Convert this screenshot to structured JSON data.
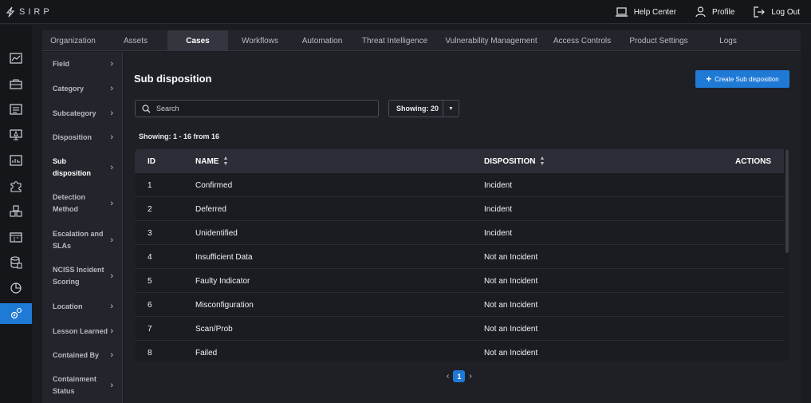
{
  "app": {
    "logo_text": "SIRP"
  },
  "top_actions": [
    {
      "name": "help-center",
      "label": "Help Center"
    },
    {
      "name": "profile",
      "label": "Profile"
    },
    {
      "name": "log-out",
      "label": "Log Out"
    }
  ],
  "tabs": [
    {
      "label": "Organization"
    },
    {
      "label": "Assets"
    },
    {
      "label": "Cases",
      "active": true
    },
    {
      "label": "Workflows"
    },
    {
      "label": "Automation"
    },
    {
      "label": "Threat Intelligence"
    },
    {
      "label": "Vulnerability Management"
    },
    {
      "label": "Access Controls"
    },
    {
      "label": "Product Settings"
    },
    {
      "label": "Logs"
    }
  ],
  "subnav": [
    {
      "label": "Field"
    },
    {
      "label": "Category"
    },
    {
      "label": "Subcategory"
    },
    {
      "label": "Disposition"
    },
    {
      "label": "Sub disposition",
      "active": true
    },
    {
      "label": "Detection Method"
    },
    {
      "label": "Escalation and SLAs"
    },
    {
      "label": "NCISS Incident Scoring"
    },
    {
      "label": "Location"
    },
    {
      "label": "Lesson Learned"
    },
    {
      "label": "Contained By"
    },
    {
      "label": "Containment Status"
    }
  ],
  "page": {
    "title": "Sub disposition",
    "create_button": "Create Sub disposition",
    "search_placeholder": "Search",
    "showing_select": "Showing: 20",
    "count_text": "Showing: 1 - 16 from 16"
  },
  "table": {
    "columns": {
      "id": "ID",
      "name": "NAME",
      "disposition": "DISPOSITION",
      "actions": "ACTIONS"
    },
    "rows": [
      {
        "id": "1",
        "name": "Confirmed",
        "disposition": "Incident"
      },
      {
        "id": "2",
        "name": "Deferred",
        "disposition": "Incident"
      },
      {
        "id": "3",
        "name": "Unidentified",
        "disposition": "Incident"
      },
      {
        "id": "4",
        "name": "Insufficient Data",
        "disposition": "Not an Incident"
      },
      {
        "id": "5",
        "name": "Faulty Indicator",
        "disposition": "Not an Incident"
      },
      {
        "id": "6",
        "name": "Misconfiguration",
        "disposition": "Not an Incident"
      },
      {
        "id": "7",
        "name": "Scan/Prob",
        "disposition": "Not an Incident"
      },
      {
        "id": "8",
        "name": "Failed",
        "disposition": "Not an Incident"
      }
    ]
  },
  "pagination": {
    "current": "1"
  },
  "rail_icons": [
    "dashboard-icon",
    "briefcase-icon",
    "list-icon",
    "monitor-alert-icon",
    "chart-icon",
    "puzzle-icon",
    "cubes-icon",
    "calendar-icon",
    "database-icon",
    "pie-chart-icon",
    "settings-gears-icon"
  ],
  "colors": {
    "accent": "#1f7ad6",
    "background": "#1b1c21",
    "panel": "#23252c"
  }
}
